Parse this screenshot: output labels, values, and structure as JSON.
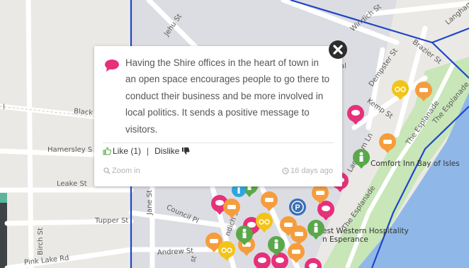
{
  "streets": {
    "jehu": "Jehu St",
    "windich": "Windich St",
    "langham": "Langham L",
    "brazier": "Brazier St",
    "dempster": "Dempster St",
    "kemp": "Kemp St",
    "esplanade_1": "The Esplanade",
    "esplanade_2": "The Esplanade",
    "esplanade_3": "The Esplanade",
    "black": "Black",
    "hamersley": "Hamersley S",
    "leake": "Leake St",
    "jane": "Jane St",
    "council": "Council Pl",
    "tupper": "Tupper St",
    "birch": "Birch St",
    "andrew": "Andrew St",
    "pink_lake": "Pink Lake Rd",
    "langham_ln": "Langham Ln",
    "l_fragment": "l",
    "al_fragment": "al",
    "t_fragment": "t",
    "st_fragment": "st",
    "windich_fragment": "ndich St"
  },
  "places": {
    "comfort_inn": "Comfort Inn Bay of Isles",
    "best_western_1": "est Western Hospitality",
    "best_western_2": "n Esperance"
  },
  "popup": {
    "comment": "Having the Shire offices in the heart of town in an open space encourages people to go there to conduct their business and be more involved in local politics. It sends a positive message to visitors.",
    "like_label": "Like (1)",
    "separator": "|",
    "dislike_label": "Dislike",
    "zoom_label": "Zoom in",
    "time_ago": "16 days ago"
  },
  "colors": {
    "comment_pin": "#e6307a",
    "car_pin": "#f59d3d",
    "bike_pin": "#f2c418",
    "person_pin": "#5aa84a",
    "parking_pin": "#3b6fb6",
    "info_pin": "#2ea6df",
    "water": "#8fb8e8",
    "boundary": "#1f45c9"
  },
  "pins": [
    {
      "type": "comment",
      "icon": "comment-icon"
    },
    {
      "type": "bike",
      "icon": "bicycle-icon"
    },
    {
      "type": "car",
      "icon": "car-icon"
    },
    {
      "type": "person",
      "icon": "person-icon"
    },
    {
      "type": "parking",
      "icon": "parking-icon"
    }
  ]
}
